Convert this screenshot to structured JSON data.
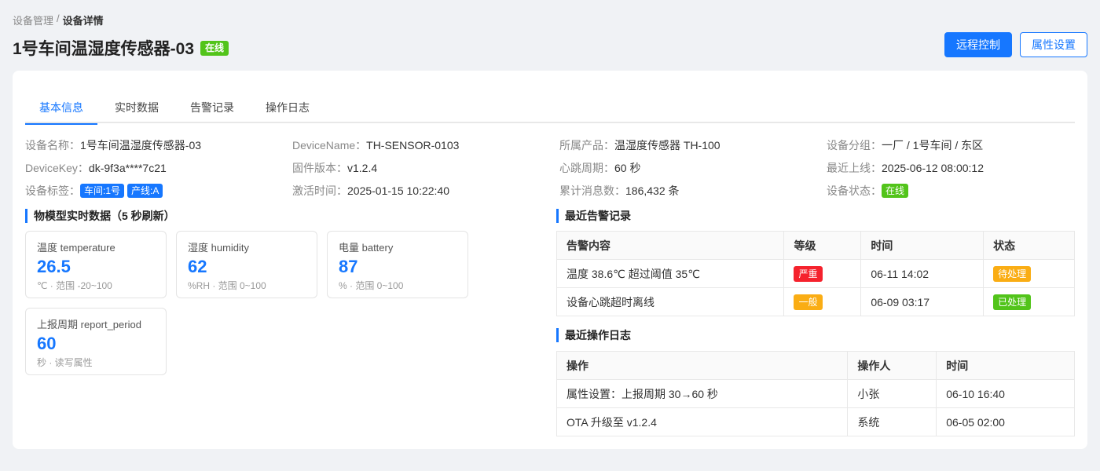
{
  "breadcrumb": {
    "parent": "设备管理",
    "separator": "/",
    "current": "设备详情"
  },
  "title": "1号车间温湿度传感器-03",
  "status_tag": "在线",
  "buttons": {
    "remote": "远程控制",
    "props": "属性设置"
  },
  "tabs": [
    "基本信息",
    "实时数据",
    "告警记录",
    "操作日志"
  ],
  "info": {
    "name_lbl": "设备名称：",
    "name_val": "1号车间温湿度传感器-03",
    "dn_lbl": "DeviceName：",
    "dn_val": "TH-SENSOR-0103",
    "product_lbl": "所属产品：",
    "product_val": "温湿度传感器 TH-100",
    "group_lbl": "设备分组：",
    "group_val": "一厂 / 1号车间 / 东区",
    "key_lbl": "DeviceKey：",
    "key_val": "dk-9f3a****7c21",
    "fw_lbl": "固件版本：",
    "fw_val": "v1.2.4",
    "hb_lbl": "心跳周期：",
    "hb_val": "60 秒",
    "last_lbl": "最近上线：",
    "last_val": "2025-06-12 08:00:12",
    "tags_lbl": "设备标签：",
    "tag1": "车间:1号",
    "tag2": "产线:A",
    "act_lbl": "激活时间：",
    "act_val": "2025-01-15 10:22:40",
    "msg_lbl": "累计消息数：",
    "msg_val": "186,432 条",
    "status_lbl": "设备状态：",
    "status_val": "在线"
  },
  "props_title": "物模型实时数据（5 秒刷新）",
  "props": [
    {
      "name": "温度 temperature",
      "value": "26.5",
      "desc": "℃ · 范围 -20~100"
    },
    {
      "name": "湿度 humidity",
      "value": "62",
      "desc": "%RH · 范围 0~100"
    },
    {
      "name": "电量 battery",
      "value": "87",
      "desc": "% · 范围 0~100"
    },
    {
      "name": "上报周期 report_period",
      "value": "60",
      "desc": "秒 · 读写属性"
    }
  ],
  "alarms": {
    "title": "最近告警记录",
    "headers": [
      "告警内容",
      "等级",
      "时间",
      "状态"
    ],
    "rows": [
      {
        "content": "温度 38.6℃ 超过阈值 35℃",
        "level": "严重",
        "time": "06-11 14:02",
        "state": "待处理"
      },
      {
        "content": "设备心跳超时离线",
        "level": "一般",
        "time": "06-09 03:17",
        "state": "已处理"
      }
    ]
  },
  "logs": {
    "title": "最近操作日志",
    "headers": [
      "操作",
      "操作人",
      "时间"
    ],
    "rows": [
      {
        "op": "属性设置：上报周期 30→60 秒",
        "user": "小张",
        "time": "06-10 16:40"
      },
      {
        "op": "OTA 升级至 v1.2.4",
        "user": "系统",
        "time": "06-05 02:00"
      }
    ]
  },
  "colors": {
    "primary": "#1677ff",
    "success": "#52c41a",
    "danger": "#f5222d",
    "warning": "#faad14"
  }
}
